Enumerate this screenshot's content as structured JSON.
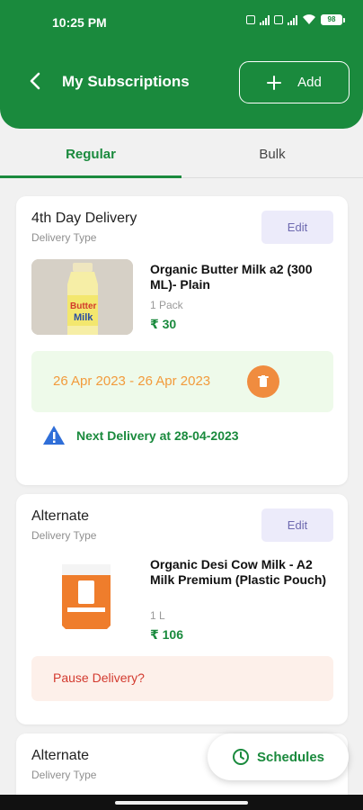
{
  "status_bar": {
    "time": "10:25 PM",
    "battery": "98",
    "sim1": "4G",
    "sim2": "4G"
  },
  "header": {
    "title": "My Subscriptions",
    "add_label": "Add"
  },
  "tabs": [
    {
      "label": "Regular",
      "active": true
    },
    {
      "label": "Bulk",
      "active": false
    }
  ],
  "subscriptions": [
    {
      "delivery_type": "4th Day Delivery",
      "type_caption": "Delivery Type",
      "edit_label": "Edit",
      "product_name": "Organic Butter Milk  a2 (300 ML)- Plain",
      "quantity": "1 Pack",
      "price": "₹ 30",
      "date_range": "26 Apr 2023 - 26 Apr 2023",
      "next_delivery": "Next Delivery at 28-04-2023",
      "image_text": "Butter Milk"
    },
    {
      "delivery_type": "Alternate",
      "type_caption": "Delivery Type",
      "edit_label": "Edit",
      "product_name": "Organic Desi Cow Milk - A2 Milk Premium (Plastic Pouch)",
      "quantity": "1 L",
      "price": "₹ 106",
      "pause_label": "Pause Delivery?"
    },
    {
      "delivery_type": "Alternate",
      "type_caption": "Delivery Type"
    }
  ],
  "schedules_label": "Schedules",
  "colors": {
    "brand_green": "#1a8a3d",
    "orange": "#f08c3f",
    "edit_bg": "#ecebfa",
    "pause_bg": "#fdf0ea",
    "date_bg": "#eefaea"
  }
}
